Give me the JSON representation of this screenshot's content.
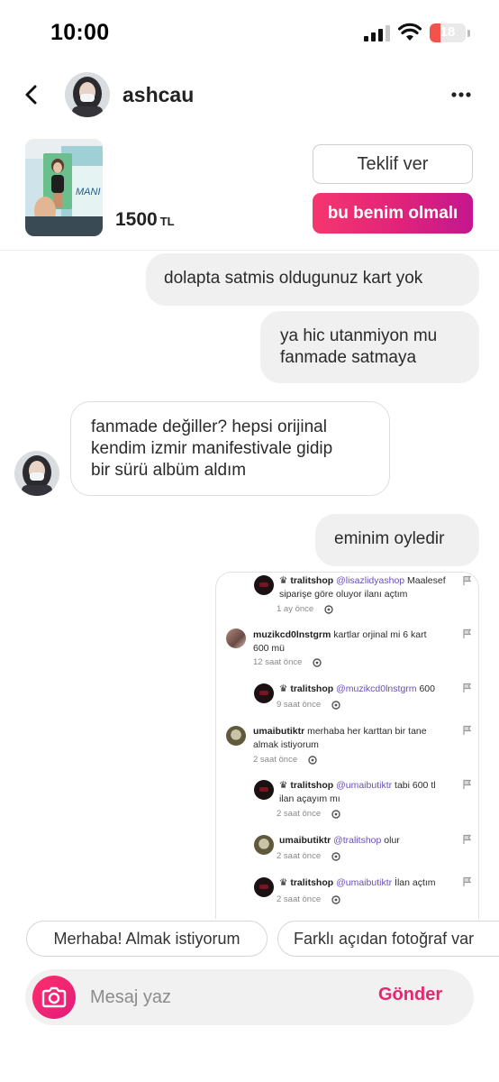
{
  "status_bar": {
    "time": "10:00",
    "battery_level": "18",
    "battery_fraction": 0.18,
    "icons": [
      "signal-icon",
      "wifi-icon",
      "battery-icon"
    ]
  },
  "header": {
    "username": "ashcau",
    "icons": [
      "back-icon",
      "avatar",
      "more-icon"
    ]
  },
  "product": {
    "price": "1500",
    "currency": "TL",
    "offer_label": "Teklif ver",
    "buy_label": "bu benim olmalı"
  },
  "messages": [
    {
      "direction": "outgoing",
      "lines": [
        "dolapta satmis oldugunuz kart yok"
      ]
    },
    {
      "direction": "outgoing",
      "lines": [
        "ya hic utanmiyon mu",
        "fanmade satmaya"
      ]
    },
    {
      "direction": "incoming",
      "lines": [
        "fanmade değiller? hepsi orijinal",
        "kendim izmir manifestivale gidip",
        "bir sürü albüm aldım"
      ]
    },
    {
      "direction": "outgoing",
      "lines": [
        "eminim oyledir"
      ]
    }
  ],
  "shared_image": {
    "comments": [
      {
        "user": "♛ tralitshop",
        "mention": "@lisazlidyashop",
        "text_lines": [
          "Maalesef",
          "siparişe göre oluyor ilanı açtım"
        ],
        "time": "1 ay önce"
      },
      {
        "user": "muzikcd0lnstgrm",
        "mention": "",
        "text_lines": [
          "kartlar orjinal mi 6 kart",
          "600 mü"
        ],
        "time": "12 saat önce"
      },
      {
        "user": "♛ tralitshop",
        "mention": "@muzikcd0lnstgrm",
        "text_lines": [
          "600"
        ],
        "time": "9 saat önce"
      },
      {
        "user": "umaibutiktr",
        "mention": "",
        "text_lines": [
          "merhaba her karttan bir tane",
          "almak istiyorum"
        ],
        "time": "2 saat önce"
      },
      {
        "user": "♛ tralitshop",
        "mention": "@umaibutiktr",
        "text_lines": [
          "tabi 600 tl",
          "ilan açayım mı"
        ],
        "time": "2 saat önce"
      },
      {
        "user": "umaibutiktr",
        "mention": "@tralitshop",
        "text_lines": [
          "olur"
        ],
        "time": "2 saat önce"
      },
      {
        "user": "♛ tralitshop",
        "mention": "@umaibutiktr",
        "text_lines": [
          "İlan açtım"
        ],
        "time": "2 saat önce"
      }
    ]
  },
  "quick_replies": [
    "Merhaba! Almak istiyorum",
    "Farklı açıdan fotoğraf var"
  ],
  "composer": {
    "placeholder": "Mesaj yaz",
    "send_label": "Gönder",
    "icons": [
      "camera-icon"
    ]
  },
  "colors": {
    "accent": "#e8266f",
    "gradient_start": "#f6366f",
    "gradient_end": "#c5168f",
    "mention": "#6a4fb5",
    "battery_low": "#f4534b"
  }
}
